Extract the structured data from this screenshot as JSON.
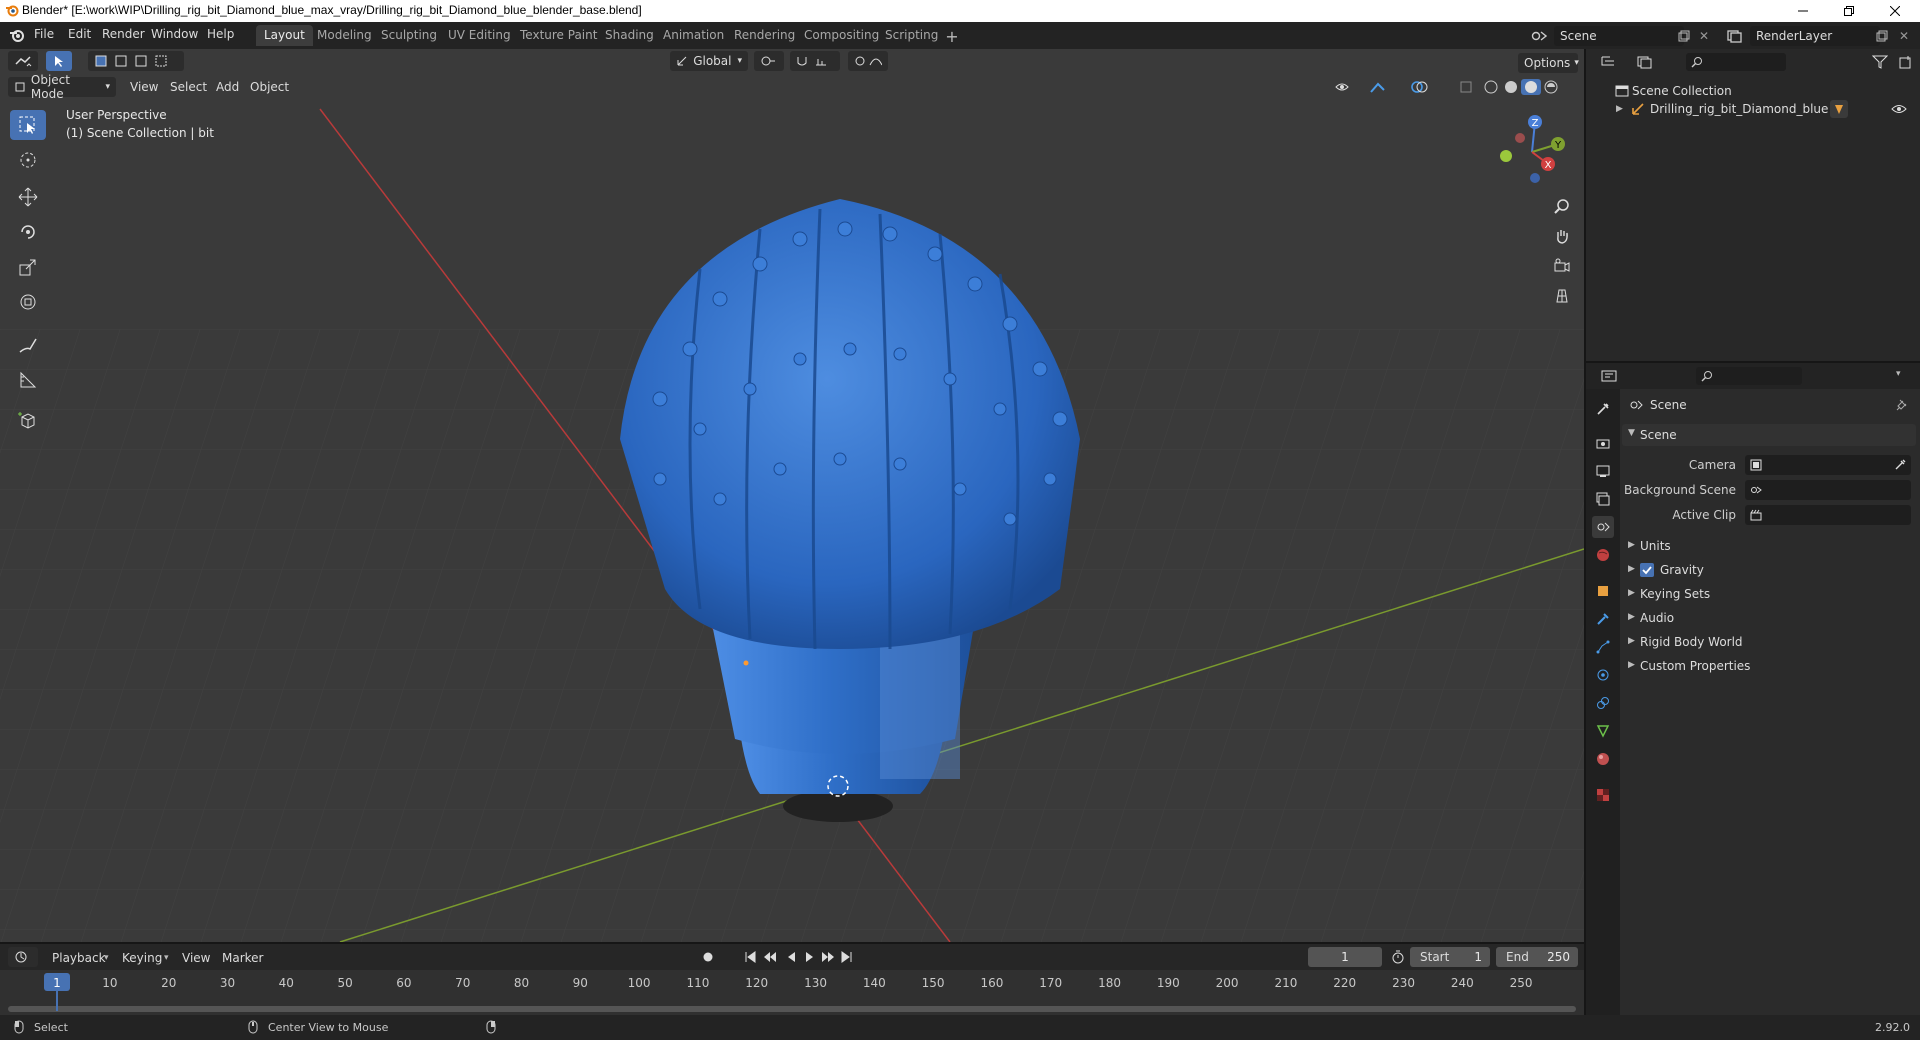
{
  "window": {
    "title": "Blender* [E:\\work\\WIP\\Drilling_rig_bit_Diamond_blue_max_vray/Drilling_rig_bit_Diamond_blue_blender_base.blend]"
  },
  "menu": [
    "File",
    "Edit",
    "Render",
    "Window",
    "Help"
  ],
  "workspaces": [
    "Layout",
    "Modeling",
    "Sculpting",
    "UV Editing",
    "Texture Paint",
    "Shading",
    "Animation",
    "Rendering",
    "Compositing",
    "Scripting"
  ],
  "active_workspace": "Layout",
  "scene_selector": {
    "scene": "Scene",
    "view_layer": "RenderLayer"
  },
  "viewport": {
    "mode": "Object Mode",
    "menus": [
      "View",
      "Select",
      "Add",
      "Object"
    ],
    "transform_orientation": "Global",
    "options_label": "Options",
    "overlay_line1": "User Perspective",
    "overlay_line2": "(1) Scene Collection | bit",
    "gizmo_axes": [
      "Z",
      "Y",
      "X"
    ]
  },
  "outliner": {
    "root": "Scene Collection",
    "object": "Drilling_rig_bit_Diamond_blue"
  },
  "properties": {
    "header": "Scene",
    "panel": "Scene",
    "camera_label": "Camera",
    "background_scene_label": "Background Scene",
    "active_clip_label": "Active Clip",
    "sections": [
      "Units",
      "Gravity",
      "Keying Sets",
      "Audio",
      "Rigid Body World",
      "Custom Properties"
    ],
    "gravity_checked": true
  },
  "timeline": {
    "menus": [
      "Playback",
      "Keying",
      "View",
      "Marker"
    ],
    "current_frame": "1",
    "start_label": "Start",
    "start": "1",
    "end_label": "End",
    "end": "250",
    "ruler": [
      "1",
      "10",
      "20",
      "30",
      "40",
      "50",
      "60",
      "70",
      "80",
      "90",
      "100",
      "110",
      "120",
      "130",
      "140",
      "150",
      "160",
      "170",
      "180",
      "190",
      "200",
      "210",
      "220",
      "230",
      "240",
      "250"
    ]
  },
  "statusbar": {
    "left": "Select",
    "middle": "Center View to Mouse",
    "version": "2.92.0"
  },
  "colors": {
    "accent": "#4772b3",
    "object_blue": "#2f6fc8",
    "x_axis": "#c0392b",
    "y_axis": "#7fa030"
  }
}
